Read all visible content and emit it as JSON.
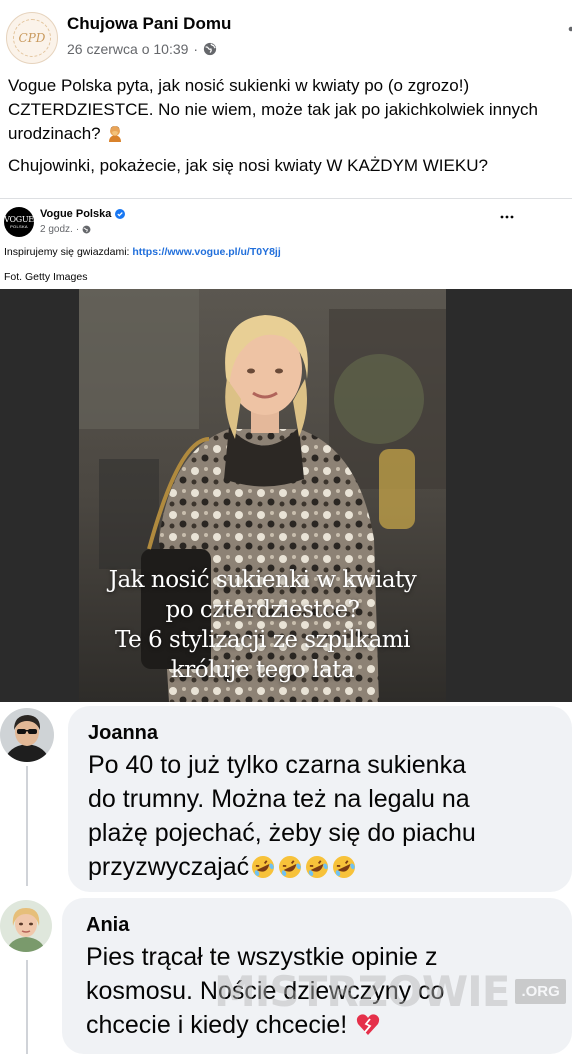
{
  "post": {
    "page_name": "Chujowa Pani Domu",
    "page_logo_text": "CPD",
    "date": "26 czerwca o 10:39",
    "separator": "·",
    "visibility_icon": "globe-icon",
    "paragraph_1": "Vogue Polska pyta, jak nosić sukienki w kwiaty po (o zgrozo!) CZTERDZIESTCE. No nie wiem, może tak jak po jakichkolwiek innych urodzinach?",
    "paragraph_1_emoji": "person-facepalming-emoji",
    "paragraph_2": "Chujowinki, pokażecie, jak się nosi kwiaty W KAŻDYM WIEKU?"
  },
  "shared_post": {
    "avatar_line1": "VOGUE",
    "avatar_line2": "POLSKA",
    "name": "Vogue Polska",
    "verified_icon": "verified-badge-icon",
    "time": "2 godz.",
    "separator": "·",
    "text_prefix": "Inspirujemy się gwiazdami: ",
    "link": "https://www.vogue.pl/u/T0Y8jj",
    "credit": "Fot. Getty Images",
    "image_caption": [
      "Jak nosić sukienki w kwiaty",
      "po czterdziestce?",
      "Te 6 stylizacji ze szpilkami",
      "króluje tego lata"
    ]
  },
  "comments": [
    {
      "author": "Joanna",
      "lines": [
        "Po 40 to już tylko czarna sukienka",
        "do trumny. Można też na legalu na",
        "plażę pojechać, żeby się do piachu",
        "przyzwyczajać"
      ],
      "emoji": [
        "rolling-laughing-emoji",
        "rolling-laughing-emoji",
        "rolling-laughing-emoji",
        "rolling-laughing-emoji"
      ]
    },
    {
      "author": "Ania",
      "lines": [
        "Pies trącał te wszystkie opinie z",
        "kosmosu. Noście dziewczyny co",
        "chcecie i kiedy chcecie!"
      ],
      "emoji": [
        "heart-exclamation-emoji"
      ]
    }
  ],
  "watermark": {
    "text": "MISTRZOWIE",
    "suffix": ".ORG"
  },
  "colors": {
    "link": "#216fdb",
    "bubble": "#f0f2f5",
    "meta": "#65676b",
    "verified": "#1877f2"
  }
}
